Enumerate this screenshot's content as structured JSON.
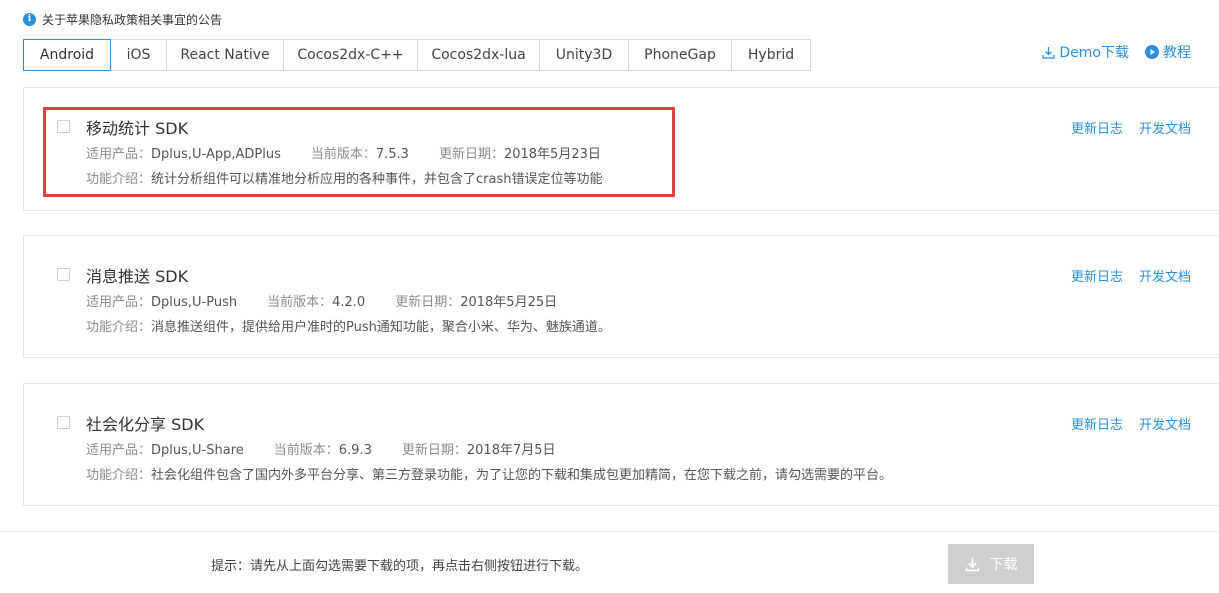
{
  "notice": {
    "icon": "info-icon",
    "text": "关于苹果隐私政策相关事宜的公告"
  },
  "tabs": [
    {
      "label": "Android",
      "active": true
    },
    {
      "label": "iOS"
    },
    {
      "label": "React Native"
    },
    {
      "label": "Cocos2dx-C++"
    },
    {
      "label": "Cocos2dx-lua"
    },
    {
      "label": "Unity3D"
    },
    {
      "label": "PhoneGap"
    },
    {
      "label": "Hybrid"
    }
  ],
  "top_links": {
    "demo": "Demo下载",
    "tutorial": "教程"
  },
  "sdks": [
    {
      "title": "移动统计 SDK",
      "products_label": "适用产品：",
      "products": "Dplus,U-App,ADPlus",
      "version_label": "当前版本：",
      "version": "7.5.3",
      "date_label": "更新日期：",
      "date": "2018年5月23日",
      "desc_label": "功能介绍：",
      "desc": "统计分析组件可以精准地分析应用的各种事件，并包含了crash错误定位等功能",
      "changelog": "更新日志",
      "docs": "开发文档"
    },
    {
      "title": "消息推送 SDK",
      "products_label": "适用产品：",
      "products": "Dplus,U-Push",
      "version_label": "当前版本：",
      "version": "4.2.0",
      "date_label": "更新日期：",
      "date": "2018年5月25日",
      "desc_label": "功能介绍：",
      "desc": "消息推送组件，提供给用户准时的Push通知功能，聚合小米、华为、魅族通道。",
      "changelog": "更新日志",
      "docs": "开发文档"
    },
    {
      "title": "社会化分享 SDK",
      "products_label": "适用产品：",
      "products": "Dplus,U-Share",
      "version_label": "当前版本：",
      "version": "6.9.3",
      "date_label": "更新日期：",
      "date": "2018年7月5日",
      "desc_label": "功能介绍：",
      "desc": "社会化组件包含了国内外多平台分享、第三方登录功能，为了让您的下载和集成包更加精简，在您下载之前，请勾选需要的平台。",
      "changelog": "更新日志",
      "docs": "开发文档"
    }
  ],
  "footer": {
    "hint": "提示：请先从上面勾选需要下载的项，再点击右侧按钮进行下载。",
    "download": "下载"
  },
  "colors": {
    "accent": "#2b8fdc",
    "highlight": "#e04040",
    "disabled_button": "#cfcfcf"
  }
}
